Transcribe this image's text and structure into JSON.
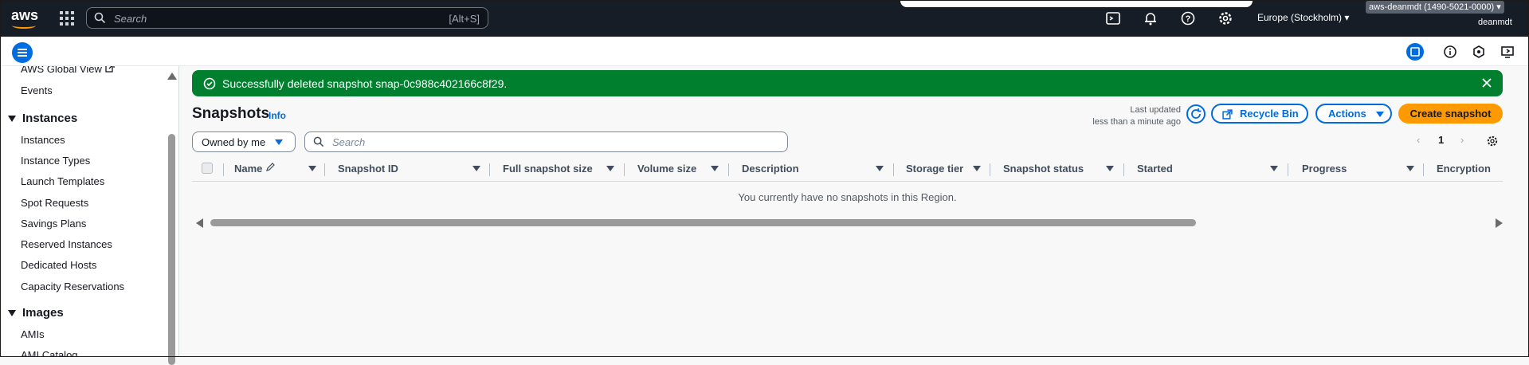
{
  "topbar": {
    "logo_text": "aws",
    "search_placeholder": "Search",
    "search_shortcut": "[Alt+S]",
    "region": "Europe (Stockholm)",
    "account": "aws-deanmdt (1490-5021-0000)",
    "user": "deanmdt"
  },
  "sidebar": {
    "global_view": "AWS Global View",
    "events": "Events",
    "instances_header": "Instances",
    "instances_items": [
      "Instances",
      "Instance Types",
      "Launch Templates",
      "Spot Requests",
      "Savings Plans",
      "Reserved Instances",
      "Dedicated Hosts",
      "Capacity Reservations"
    ],
    "images_header": "Images",
    "images_items": [
      "AMIs",
      "AMI Catalog"
    ]
  },
  "flash": {
    "message": "Successfully deleted snapshot snap-0c988c402166c8f29."
  },
  "header": {
    "title": "Snapshots",
    "info": "Info",
    "last_updated_label": "Last updated",
    "last_updated_value": "less than a minute ago",
    "recycle_bin": "Recycle Bin",
    "actions": "Actions",
    "create": "Create snapshot"
  },
  "filters": {
    "owner_value": "Owned by me",
    "search_placeholder": "Search",
    "page": "1"
  },
  "table": {
    "columns": [
      "Name",
      "Snapshot ID",
      "Full snapshot size",
      "Volume size",
      "Description",
      "Storage tier",
      "Snapshot status",
      "Started",
      "Progress",
      "Encryption"
    ],
    "empty_message": "You currently have no snapshots in this Region."
  },
  "colors": {
    "topbar": "#161d26",
    "success": "#00802f",
    "accent": "#006ce0",
    "primary_button": "#ff9900"
  }
}
